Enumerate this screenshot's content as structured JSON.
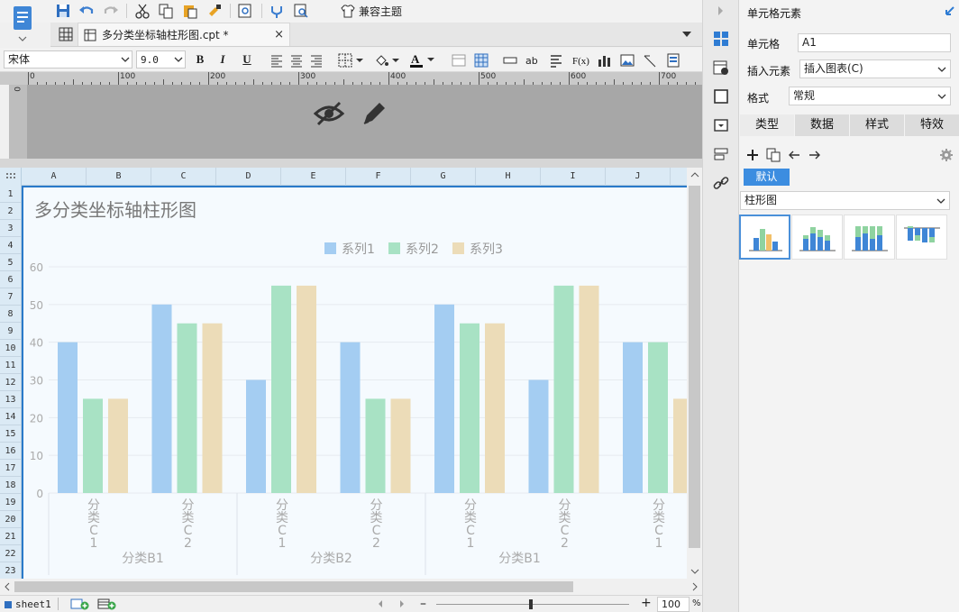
{
  "toolbar": {
    "theme_label": "兼容主题"
  },
  "tab": {
    "title": "多分类坐标轴柱形图.cpt *",
    "close": "×"
  },
  "format": {
    "font_name": "宋体",
    "font_size": "9.0",
    "bold": "B",
    "italic": "I",
    "underline": "U"
  },
  "ruler": {
    "ticks": [
      "0",
      "100",
      "200",
      "300",
      "400",
      "500",
      "600",
      "700"
    ]
  },
  "grid": {
    "columns": [
      "A",
      "B",
      "C",
      "D",
      "E",
      "F",
      "G",
      "H",
      "I",
      "J"
    ],
    "rows": [
      "1",
      "2",
      "3",
      "4",
      "5",
      "6",
      "7",
      "8",
      "9",
      "10",
      "11",
      "12",
      "13",
      "14",
      "15",
      "16",
      "17",
      "18",
      "19",
      "20",
      "21",
      "22",
      "23"
    ]
  },
  "chart_data": {
    "type": "bar",
    "title": "多分类坐标轴柱形图",
    "legend_position": "top-center",
    "grid": true,
    "ylim": [
      0,
      60
    ],
    "yticks": [
      0,
      10,
      20,
      30,
      40,
      50,
      60
    ],
    "categories": [
      "分类C1",
      "分类C2",
      "分类C1",
      "分类C2",
      "分类C1",
      "分类C2",
      "分类C1"
    ],
    "groups": [
      {
        "name": "分类B1",
        "span": [
          0,
          1
        ]
      },
      {
        "name": "分类B2",
        "span": [
          2,
          3
        ]
      },
      {
        "name": "分类B1",
        "span": [
          4,
          5
        ]
      }
    ],
    "series": [
      {
        "name": "系列1",
        "color": "#a4cdf2",
        "values": [
          40,
          50,
          30,
          40,
          50,
          30,
          40
        ]
      },
      {
        "name": "系列2",
        "color": "#a8e2c4",
        "values": [
          25,
          45,
          55,
          25,
          45,
          55,
          40
        ]
      },
      {
        "name": "系列3",
        "color": "#ecdcb8",
        "values": [
          25,
          45,
          55,
          25,
          45,
          55,
          25
        ]
      }
    ]
  },
  "sheet": {
    "name": "sheet1",
    "zoom": "100",
    "zoom_unit": "%"
  },
  "panel": {
    "title": "单元格元素",
    "cell_label": "单元格",
    "cell_value": "A1",
    "insert_label": "插入元素",
    "insert_value": "插入图表(C)",
    "format_label": "格式",
    "format_value": "常规",
    "tabs": [
      "类型",
      "数据",
      "样式",
      "特效"
    ],
    "default_tag": "默认",
    "chart_type": "柱形图"
  },
  "colors": {
    "accent": "#2a7ac9",
    "selected": "#4a90d9"
  }
}
